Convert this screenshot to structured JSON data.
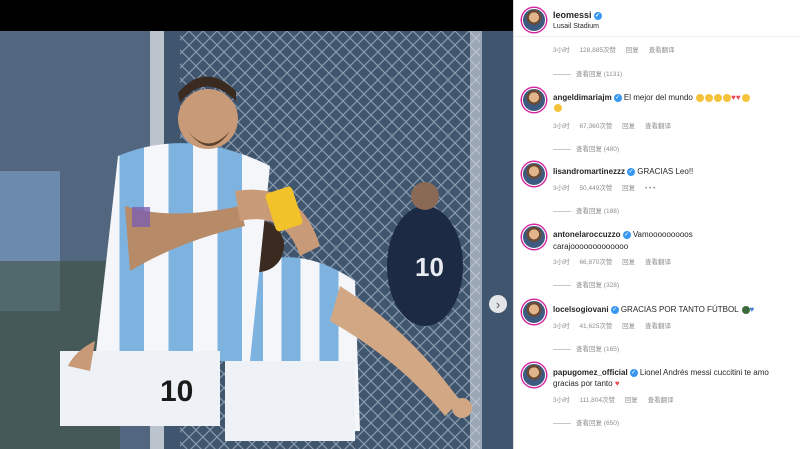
{
  "post": {
    "username": "leomessi",
    "location": "Lusail Stadium",
    "meta": {
      "time": "3小时",
      "likes": "128,885次赞",
      "reply": "回复",
      "translate": "查看翻译"
    },
    "view_replies": "查看回复 (1131)"
  },
  "photo": {
    "jersey_number": "10",
    "captain_band": "Captain"
  },
  "comments": [
    {
      "username": "angeldimariajm",
      "text": "El mejor del mundo",
      "emoji_icons": [
        "crying-face-icon",
        "crying-face-icon",
        "clap-icon",
        "clap-icon",
        "heart-icon",
        "heart-icon",
        "face-icon",
        "face-icon"
      ],
      "time": "3小时",
      "likes": "67,360次赞",
      "reply": "回复",
      "translate": "查看翻译",
      "view_replies": "查看回复 (480)"
    },
    {
      "username": "lisandromartinezzz",
      "text": "GRACIAS Leo!!",
      "more": "• • •",
      "time": "3小时",
      "likes": "50,449次赞",
      "reply": "回复",
      "translate": "",
      "view_replies": "查看回复 (188)"
    },
    {
      "username": "antonelaroccuzzo",
      "text": "Vamooooooooos",
      "text2": "carajooooooooooooo",
      "time": "3小时",
      "likes": "66,870次赞",
      "reply": "回复",
      "translate": "查看翻译",
      "view_replies": "查看回复 (328)"
    },
    {
      "username": "locelsogiovani",
      "text": "GRACIAS POR TANTO FÚTBOL",
      "time": "3小时",
      "likes": "41,625次赞",
      "reply": "回复",
      "translate": "查看翻译",
      "view_replies": "查看回复 (165)"
    },
    {
      "username": "papugomez_official",
      "text": "Lionel Andrés messi cuccitini te amo",
      "text2": "gracias por tanto",
      "time": "3小时",
      "likes": "111,804次赞",
      "reply": "回复",
      "translate": "查看翻译",
      "view_replies": "查看回复 (650)"
    }
  ],
  "colors": {
    "verified": "#3897f0",
    "muted": "#8e8e8e",
    "text": "#262626",
    "heart": "#ed4956"
  },
  "icons": {
    "verified": "verified-badge-icon",
    "next": "chevron-right-icon"
  }
}
